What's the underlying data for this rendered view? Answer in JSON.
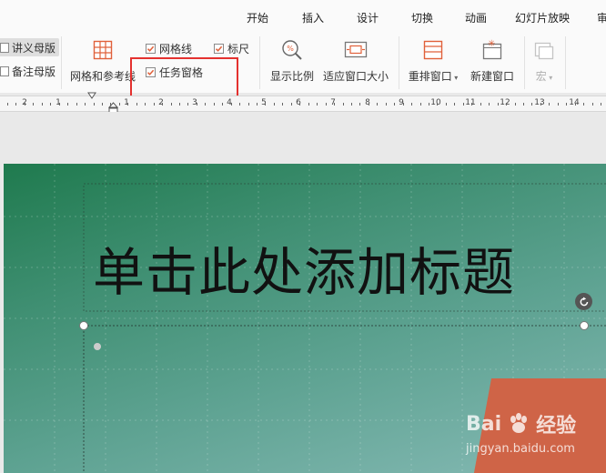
{
  "menu": {
    "tabs": [
      "开始",
      "插入",
      "设计",
      "切换",
      "动画",
      "幻灯片放映",
      "审"
    ]
  },
  "ribbon": {
    "handout_master": "讲义母版",
    "notes_master": "备注母版",
    "grid_guides": "网格和参考线",
    "gridlines": {
      "label": "网格线",
      "checked": true
    },
    "ruler": {
      "label": "标尺",
      "checked": true
    },
    "task_pane": {
      "label": "任务窗格",
      "checked": true
    },
    "show_ratio": "显示比例",
    "fit_window": "适应窗口大小",
    "arrange_window": "重排窗口",
    "new_window": "新建窗口",
    "macro": "宏"
  },
  "ruler": {
    "labels": [
      "2",
      "1",
      "1",
      "2",
      "1",
      "2",
      "3",
      "4",
      "5",
      "6",
      "7",
      "8",
      "9",
      "10",
      "11",
      "12",
      "13",
      "14"
    ]
  },
  "slide": {
    "title_placeholder": "单击此处添加标题"
  },
  "watermark": {
    "brand": "Bai",
    "brand_suffix": "经验",
    "url": "jingyan.baidu.com"
  }
}
